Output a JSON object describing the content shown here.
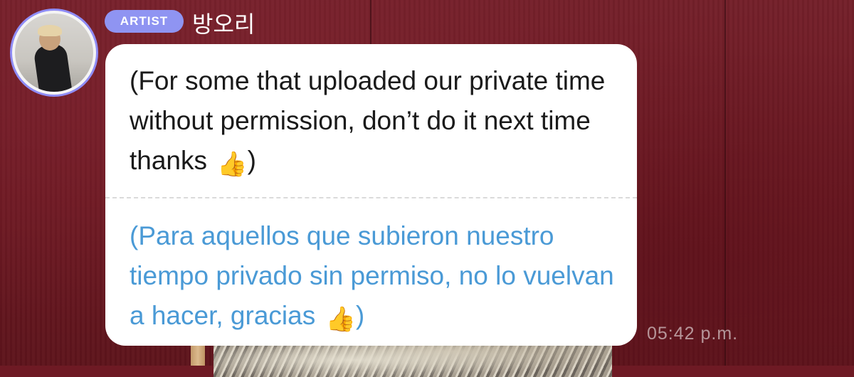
{
  "artist": {
    "badge_label": "ARTIST",
    "name": "방오리"
  },
  "message": {
    "original_text": "(For some that uploaded our private time without permission, don’t do it next time thanks",
    "original_close": ")",
    "translated_text": "(Para aquellos que subieron nuestro tiempo privado sin permiso, no lo vuelvan a hacer, gracias",
    "translated_close": ")",
    "emoji": "thumbs-up-light-skin-emoji",
    "timestamp": "05:42 p.m."
  },
  "colors": {
    "background": "#6e1a24",
    "badge": "#8f94f2",
    "avatar_ring": "#8f8cf5",
    "translation_text": "#4a9ad6",
    "bubble": "#ffffff"
  }
}
